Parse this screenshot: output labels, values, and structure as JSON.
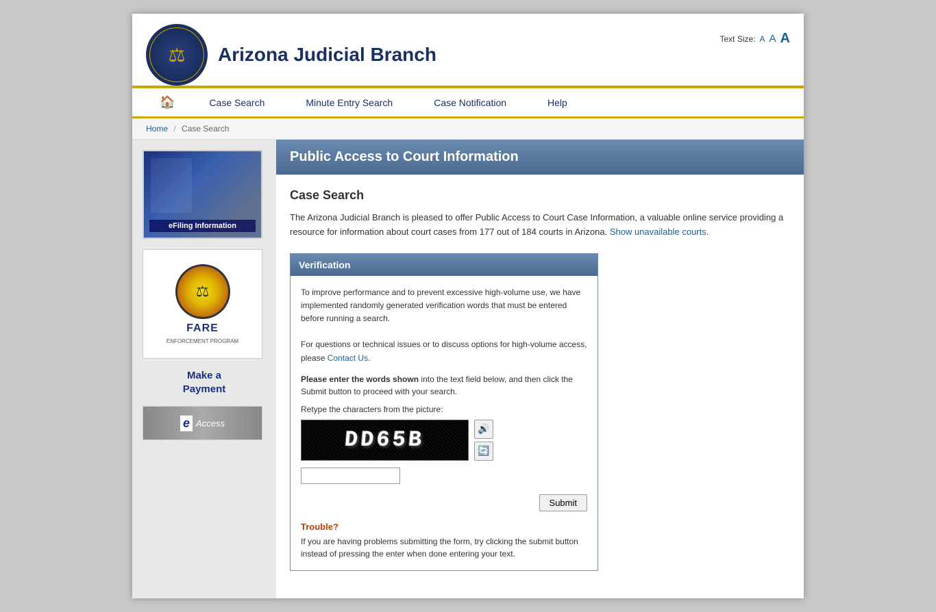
{
  "header": {
    "site_title": "Arizona Judicial Branch",
    "text_size_label": "Text Size:",
    "text_size_small": "A",
    "text_size_medium": "A",
    "text_size_large": "A"
  },
  "nav": {
    "home_icon": "🏠",
    "items": [
      {
        "id": "case-search",
        "label": "Case Search"
      },
      {
        "id": "minute-entry-search",
        "label": "Minute Entry Search"
      },
      {
        "id": "case-notification",
        "label": "Case Notification"
      },
      {
        "id": "help",
        "label": "Help"
      }
    ]
  },
  "breadcrumb": {
    "home": "Home",
    "separator": "/",
    "current": "Case Search"
  },
  "sidebar": {
    "efiling_label": "eFiling Information",
    "fare_label": "FARE",
    "fare_sub": "ENFORCEMENT PROGRAM",
    "make_payment_line1": "Make a",
    "make_payment_line2": "Payment",
    "eaccess_label": "eAccess"
  },
  "page_title": "Public Access to Court Information",
  "case_search": {
    "heading": "Case Search",
    "intro": "The Arizona Judicial Branch is pleased to offer Public Access to Court Case Information, a valuable online service providing a resource for information about court cases from 177 out of 184 courts in Arizona.",
    "show_unavailable": "Show unavailable courts."
  },
  "verification": {
    "heading": "Verification",
    "desc_p1": "To improve performance and to prevent excessive high-volume use, we have implemented randomly generated verification words that must be entered before running a search.",
    "desc_p2": "For questions or technical issues or to discuss options for high-volume access, please",
    "contact_us": "Contact Us",
    "instruction_prefix": "Please enter the words shown",
    "instruction_suffix": "into the text field below, and then click the Submit button to proceed with your search.",
    "retype_label": "Retype the characters from the picture:",
    "captcha_text": "DD65B",
    "captcha_input_value": "",
    "submit_label": "Submit",
    "audio_icon": "🔊",
    "refresh_icon": "🔄",
    "trouble_heading": "Trouble?",
    "trouble_text": "If you are having problems submitting the form, try clicking the submit button instead of pressing the enter when done entering your text."
  }
}
